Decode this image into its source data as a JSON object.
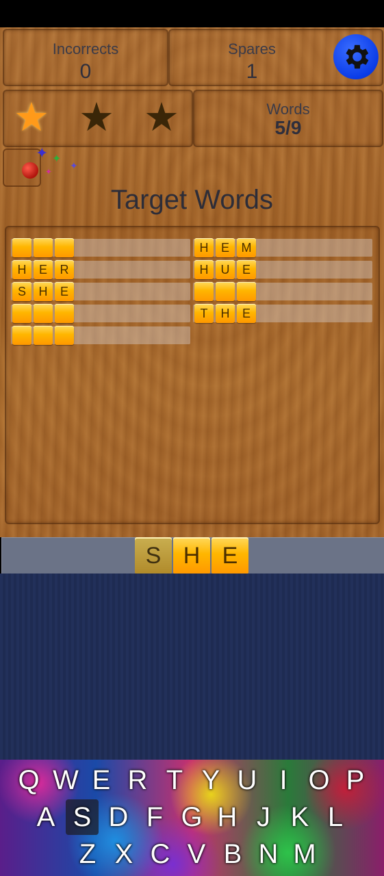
{
  "stats": {
    "incorrects_label": "Incorrects",
    "incorrects_value": "0",
    "spares_label": "Spares",
    "spares_value": "1",
    "words_label": "Words",
    "words_value": "5/9",
    "stars_earned": 1,
    "stars_total": 3
  },
  "settings_icon": "gear-icon",
  "powerup_icon": "bomb-icon",
  "title": "Target Words",
  "target_words": [
    {
      "letters": [
        "",
        "",
        ""
      ]
    },
    {
      "letters": [
        "H",
        "E",
        "R"
      ]
    },
    {
      "letters": [
        "S",
        "H",
        "E"
      ]
    },
    {
      "letters": [
        "",
        "",
        ""
      ]
    },
    {
      "letters": [
        "",
        "",
        ""
      ]
    },
    {
      "letters": [
        "H",
        "E",
        "M"
      ]
    },
    {
      "letters": [
        "H",
        "U",
        "E"
      ]
    },
    {
      "letters": [
        "",
        "",
        ""
      ]
    },
    {
      "letters": [
        "T",
        "H",
        "E"
      ]
    }
  ],
  "current_word": [
    "S",
    "H",
    "E"
  ],
  "keyboard": {
    "row1": [
      "Q",
      "W",
      "E",
      "R",
      "T",
      "Y",
      "U",
      "I",
      "O",
      "P"
    ],
    "row2": [
      "A",
      "S",
      "D",
      "F",
      "G",
      "H",
      "J",
      "K",
      "L"
    ],
    "row3": [
      "Z",
      "X",
      "C",
      "V",
      "B",
      "N",
      "M"
    ],
    "pressed": "S"
  },
  "colors": {
    "tile": "#ffb600",
    "settings_button": "#0a3ce8",
    "star_on": "#ff9a1a",
    "star_off": "#3a2608"
  }
}
